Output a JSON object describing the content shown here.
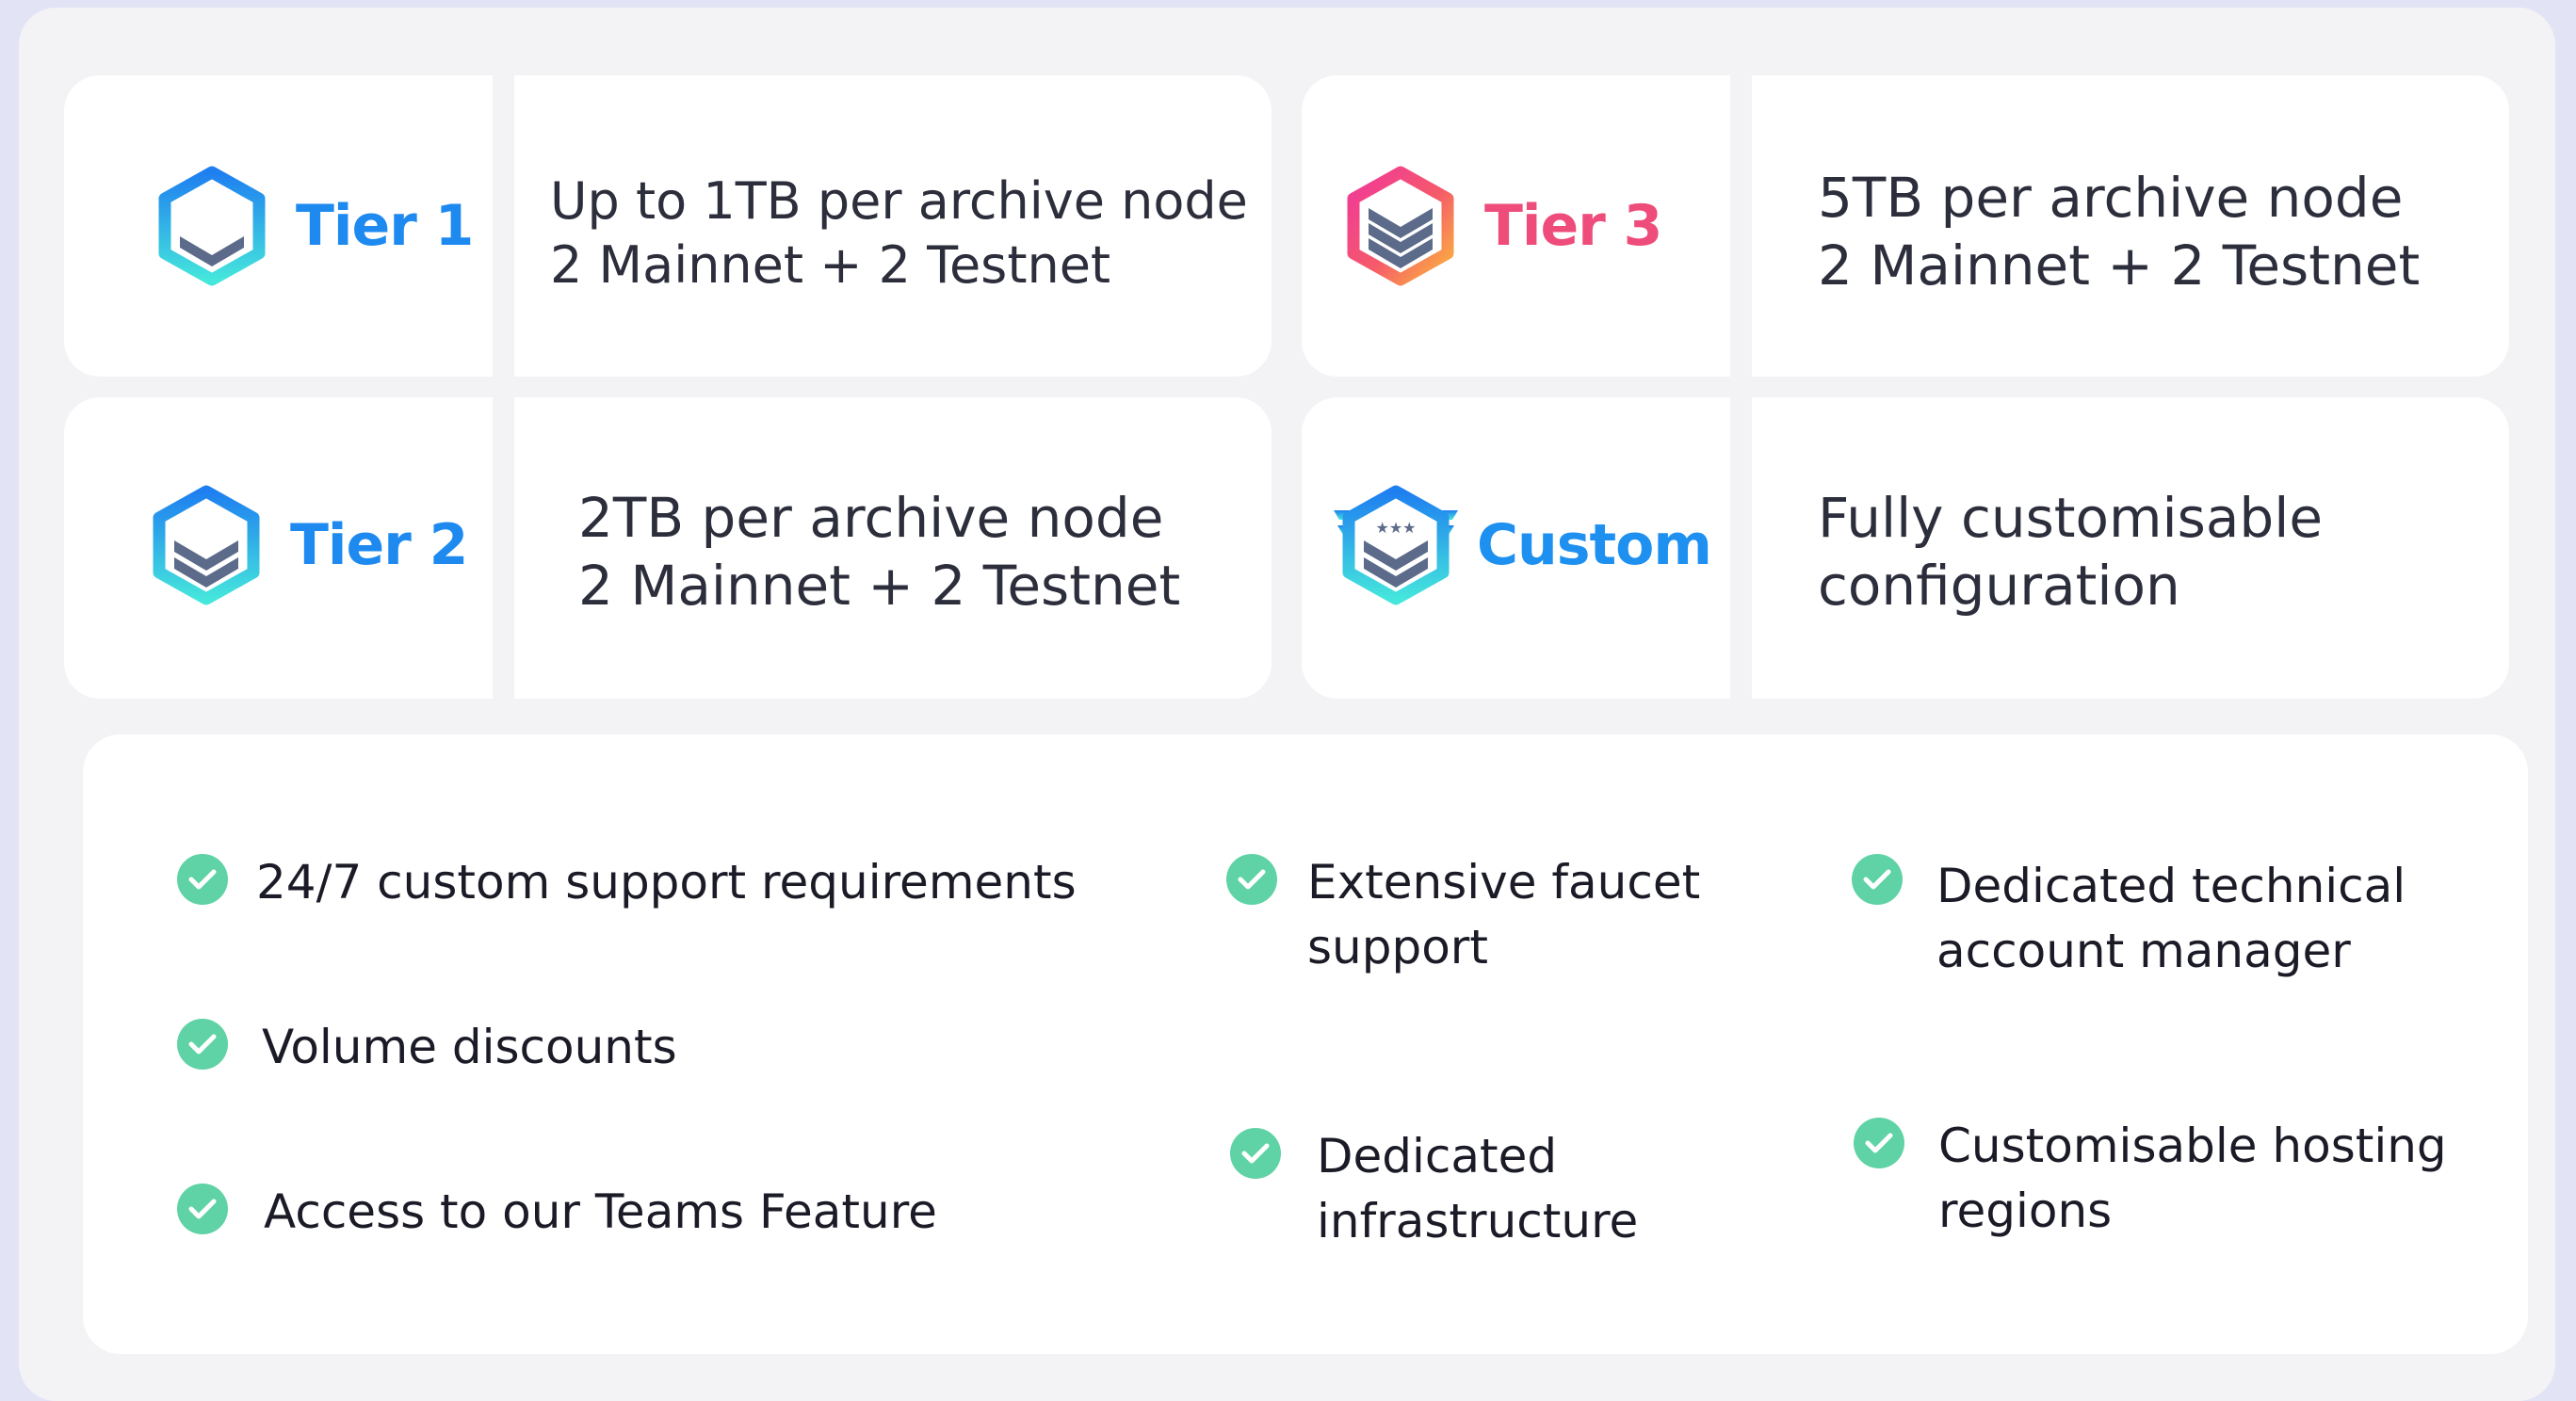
{
  "tiers": {
    "tier1": {
      "label": "Tier 1",
      "lines": [
        "Up to 1TB per archive node",
        "2 Mainnet + 2 Testnet"
      ],
      "color": "#1e90f0",
      "icon": "hexagon-stack-icon"
    },
    "tier2": {
      "label": "Tier 2",
      "lines": [
        "2TB per archive node",
        "2 Mainnet + 2 Testnet"
      ],
      "color": "#1e90f0",
      "icon": "hexagon-stack-icon"
    },
    "tier3": {
      "label": "Tier 3",
      "lines": [
        "5TB per archive node",
        "2 Mainnet + 2 Testnet"
      ],
      "color": "#ee4c7a",
      "icon": "hexagon-stack-icon"
    },
    "custom": {
      "label": "Custom",
      "lines": [
        "Fully customisable",
        "configuration"
      ],
      "color": "#1e90f0",
      "icon": "winged-hexagon-stars-icon"
    }
  },
  "features": [
    {
      "lines": [
        "24/7 custom support requirements"
      ]
    },
    {
      "lines": [
        "Volume discounts"
      ]
    },
    {
      "lines": [
        "Access to our Teams Feature"
      ]
    },
    {
      "lines": [
        "Extensive faucet",
        "support"
      ]
    },
    {
      "lines": [
        "Dedicated",
        "infrastructure"
      ]
    },
    {
      "lines": [
        "Dedicated technical",
        "account manager"
      ]
    },
    {
      "lines": [
        "Customisable hosting",
        "regions"
      ]
    }
  ],
  "colors": {
    "check": "#5fd3a5",
    "blue_gradient": [
      "#1e7ff0",
      "#45e6dc"
    ],
    "pink_gradient": [
      "#f0389a",
      "#fbb53d"
    ],
    "chevron": "#5c6b8a"
  }
}
